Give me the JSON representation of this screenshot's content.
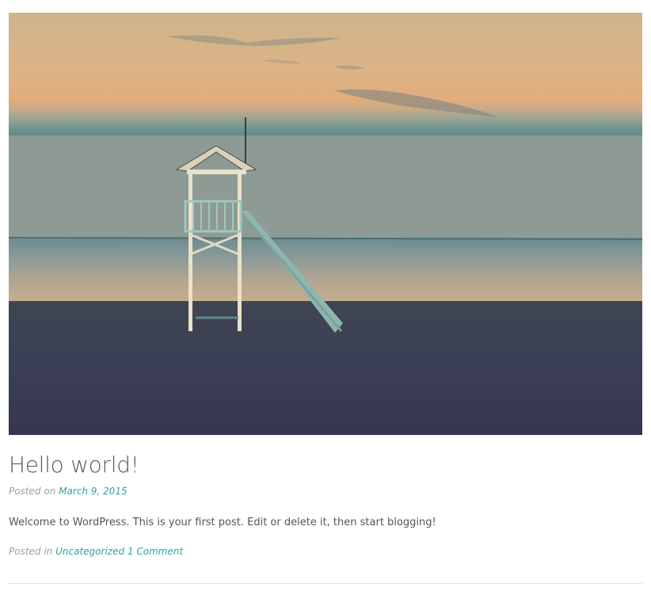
{
  "post": {
    "title": "Hello world!",
    "posted_on_label": "Posted on",
    "date": "March 9, 2015",
    "content": "Welcome to WordPress. This is your first post. Edit or delete it, then start blogging!",
    "posted_in_label": "Posted in",
    "category": "Uncategorized",
    "comments": "1 Comment"
  },
  "colors": {
    "link": "#2aa7a0",
    "title": "#5a5a5a",
    "meta": "#a0a0a0",
    "body": "#555555"
  }
}
